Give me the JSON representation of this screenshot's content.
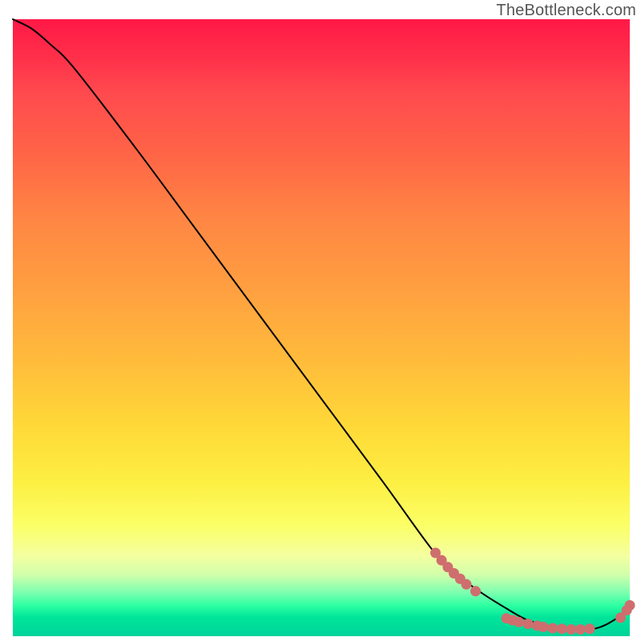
{
  "watermark": "TheBottleneck.com",
  "colors": {
    "curve": "#000000",
    "dots": "#cf6e6e"
  },
  "chart_data": {
    "type": "line",
    "title": "",
    "xlabel": "",
    "ylabel": "",
    "xlim": [
      0,
      100
    ],
    "ylim": [
      0,
      100
    ],
    "grid": false,
    "legend": false,
    "series": [
      {
        "name": "bottleneck-curve",
        "x": [
          0,
          3,
          6,
          10,
          20,
          30,
          40,
          50,
          60,
          68,
          72,
          76,
          80,
          83,
          86,
          89,
          92,
          95,
          98,
          100
        ],
        "y": [
          100,
          98.5,
          96,
          92,
          79,
          65.5,
          52,
          38.5,
          25,
          14,
          10,
          7,
          4.5,
          2.8,
          1.8,
          1.2,
          1.0,
          1.4,
          3.0,
          5.0
        ]
      }
    ],
    "marker_clusters": [
      {
        "name": "first-dot-cluster",
        "x_range": [
          68,
          76
        ],
        "y_range": [
          7,
          14
        ],
        "points": [
          {
            "x": 68.5,
            "y": 13.5
          },
          {
            "x": 69.5,
            "y": 12.3
          },
          {
            "x": 70.5,
            "y": 11.2
          },
          {
            "x": 71.5,
            "y": 10.2
          },
          {
            "x": 72.5,
            "y": 9.3
          },
          {
            "x": 73.5,
            "y": 8.4
          },
          {
            "x": 75.0,
            "y": 7.3
          }
        ]
      },
      {
        "name": "bottom-flat-cluster",
        "x_range": [
          80,
          94
        ],
        "y_range": [
          1.0,
          2.8
        ],
        "points": [
          {
            "x": 80.0,
            "y": 2.9
          },
          {
            "x": 81.0,
            "y": 2.6
          },
          {
            "x": 82.0,
            "y": 2.3
          },
          {
            "x": 83.5,
            "y": 2.0
          },
          {
            "x": 85.0,
            "y": 1.7
          },
          {
            "x": 86.0,
            "y": 1.5
          },
          {
            "x": 87.5,
            "y": 1.3
          },
          {
            "x": 89.0,
            "y": 1.2
          },
          {
            "x": 90.5,
            "y": 1.1
          },
          {
            "x": 92.0,
            "y": 1.1
          },
          {
            "x": 93.5,
            "y": 1.2
          }
        ]
      },
      {
        "name": "upturn-cluster",
        "x_range": [
          97,
          100
        ],
        "y_range": [
          2.5,
          5.2
        ],
        "points": [
          {
            "x": 98.5,
            "y": 3.0
          },
          {
            "x": 99.5,
            "y": 4.2
          },
          {
            "x": 100.0,
            "y": 5.0
          }
        ]
      }
    ]
  }
}
